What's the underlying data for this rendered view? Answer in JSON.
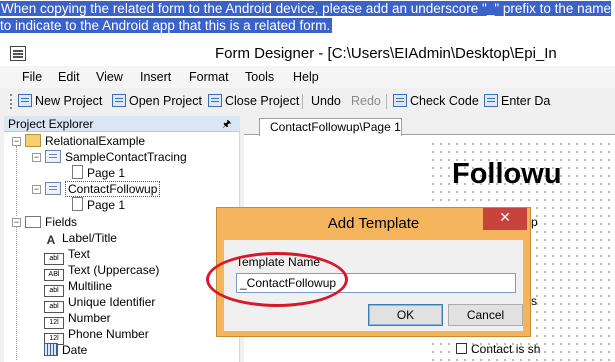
{
  "caption": "When copying the related form to the Android device, please add an underscore \"_\" prefix to the name to indicate to the Android app that this is a related form.",
  "window": {
    "title": "Form Designer - [C:\\Users\\EIAdmin\\Desktop\\Epi_In"
  },
  "menu": [
    "File",
    "Edit",
    "View",
    "Insert",
    "Format",
    "Tools",
    "Help"
  ],
  "toolbar": {
    "new_project": "New Project",
    "open_project": "Open Project",
    "close_project": "Close Project",
    "undo": "Undo",
    "redo": "Redo",
    "check_code": "Check Code",
    "enter_data": "Enter Da"
  },
  "project_explorer": {
    "title": "Project Explorer",
    "pin_icon": "pin-icon",
    "root": "RelationalExample",
    "forms": [
      {
        "name": "SampleContactTracing",
        "page": "Page 1"
      },
      {
        "name": "ContactFollowup",
        "page": "Page 1"
      }
    ],
    "fields_group": "Fields",
    "fields": [
      "Label/Title",
      "Text",
      "Text (Uppercase)",
      "Multiline",
      "Unique Identifier",
      "Number",
      "Phone Number",
      "Date"
    ],
    "field_icons": [
      "A",
      "abl",
      "ABl",
      "abl",
      "abl",
      "12l",
      "12l",
      ""
    ]
  },
  "designer": {
    "tab": "ContactFollowup\\Page 1",
    "title_fragment": "Followu",
    "fragment_1": "p",
    "fragment_2": "s",
    "checkbox_fragment": "Contact is sh"
  },
  "dialog": {
    "title": "Add Template",
    "close_glyph": "✕",
    "label": "Template Name",
    "value": "_ContactFollowup",
    "ok": "OK",
    "cancel": "Cancel"
  },
  "colors": {
    "caption_highlight": "#3b62c8",
    "dialog_frame": "#f4b45c",
    "close_button": "#c7433c",
    "annotation_circle": "#d7182a"
  }
}
